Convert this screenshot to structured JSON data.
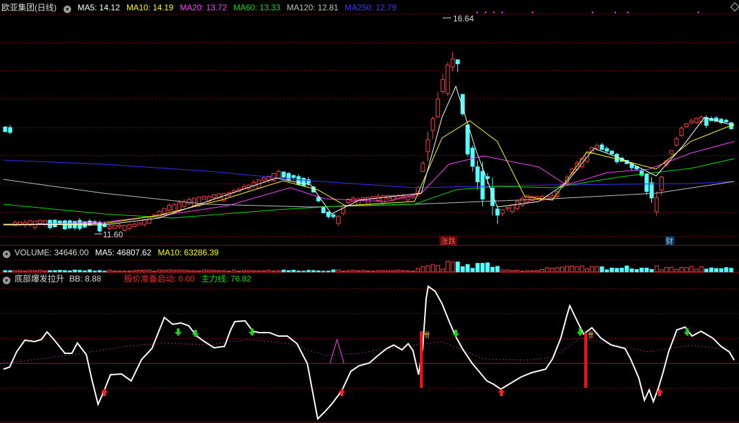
{
  "main": {
    "title": "欧亚集团(日线)",
    "ma5": "MA5: 14.12",
    "ma10": "MA10: 14.19",
    "ma20": "MA20: 13.72",
    "ma60": "MA60: 13.33",
    "ma120": "MA120: 12.81",
    "ma250": "MA250: 12.79",
    "high_label": "16.64",
    "low_label": "11.60",
    "event_marker_1": "涨跌",
    "event_marker_2": "财"
  },
  "volume": {
    "title": "VOLUME: 34646.00",
    "ma5": "MA5: 46807.62",
    "ma10": "MA10: 63286.39"
  },
  "indicator": {
    "title": "底部爆发拉升",
    "bb": "BB: 8.88",
    "launch": "股价准备启动: 0.00",
    "mainline": "主力线: 76.82"
  },
  "colors": {
    "up": "#ff3b3b",
    "down": "#54ffff",
    "ma5": "#ffffff",
    "ma10": "#ffff00",
    "ma20": "#ff40ff",
    "ma60": "#00e000",
    "ma120": "#c0c0c0",
    "ma250": "#3030ff"
  }
}
